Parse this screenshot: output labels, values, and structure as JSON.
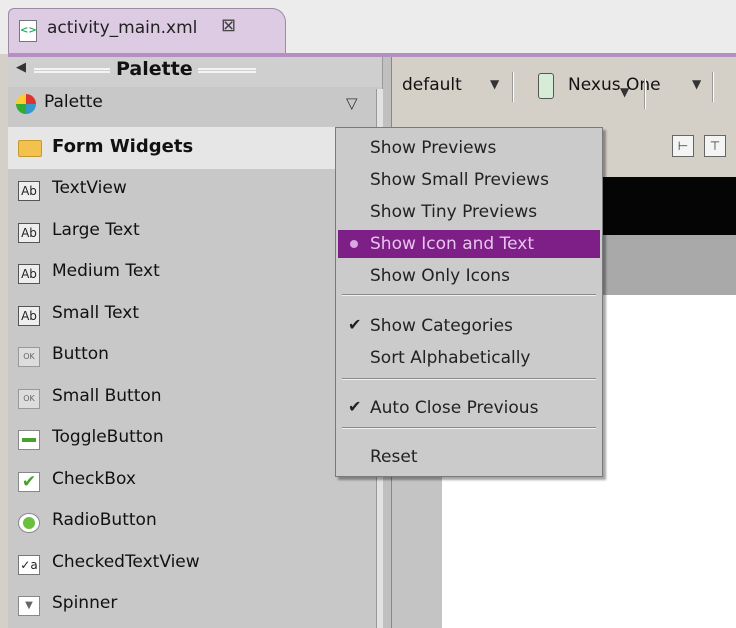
{
  "editor_tab": {
    "title": "activity_main.xml",
    "close_glyph": "⊠"
  },
  "palette": {
    "title": "Palette",
    "selector_label": "Palette",
    "category": "Form Widgets",
    "widgets": [
      {
        "label": "TextView",
        "icon": "ab-text-icon",
        "glyph": "Ab"
      },
      {
        "label": "Large Text",
        "icon": "ab-text-icon",
        "glyph": "Ab"
      },
      {
        "label": "Medium Text",
        "icon": "ab-text-icon",
        "glyph": "Ab"
      },
      {
        "label": "Small Text",
        "icon": "ab-text-icon",
        "glyph": "Ab"
      },
      {
        "label": "Button",
        "icon": "ok-button-icon",
        "glyph": "OK"
      },
      {
        "label": "Small Button",
        "icon": "ok-button-icon",
        "glyph": "OK"
      },
      {
        "label": "ToggleButton",
        "icon": "toggle-icon",
        "glyph": ""
      },
      {
        "label": "CheckBox",
        "icon": "checkbox-icon",
        "glyph": "✔"
      },
      {
        "label": "RadioButton",
        "icon": "radio-icon",
        "glyph": ""
      },
      {
        "label": "CheckedTextView",
        "icon": "checked-textview-icon",
        "glyph": "✓a"
      },
      {
        "label": "Spinner",
        "icon": "spinner-icon",
        "glyph": "▼"
      }
    ]
  },
  "toolbar": {
    "theme": "default",
    "device": "Nexus One"
  },
  "context_menu": {
    "items": [
      {
        "label": "Show Previews",
        "mark": ""
      },
      {
        "label": "Show Small Previews",
        "mark": ""
      },
      {
        "label": "Show Tiny Previews",
        "mark": ""
      },
      {
        "label": "Show Icon and Text",
        "mark": "radio",
        "selected": true
      },
      {
        "label": "Show Only Icons",
        "mark": ""
      },
      {
        "label": "Show Categories",
        "mark": "check"
      },
      {
        "label": "Sort Alphabetically",
        "mark": ""
      },
      {
        "label": "Auto Close Previous",
        "mark": "check"
      },
      {
        "label": "Reset",
        "mark": ""
      }
    ]
  },
  "colors": {
    "menu_highlight": "#7d1f86",
    "tab_background": "#dccbe3",
    "editor_border": "#b48fc2"
  }
}
